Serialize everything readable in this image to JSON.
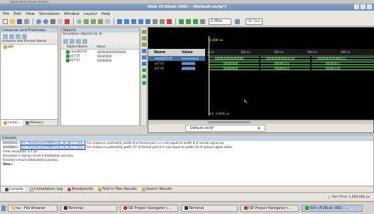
{
  "window": {
    "title": "ISim (P.28xd) (ISE) - [Default.wcfg*]",
    "sys_top_left": "Applications Places System",
    "sys_top_right": ""
  },
  "menubar": [
    "File",
    "Edit",
    "View",
    "Simulation",
    "Window",
    "Layout",
    "Help"
  ],
  "toolbar": {
    "time_field": "1.00us",
    "help_text": "ISE Text"
  },
  "instances_panel": {
    "title": "Instances and Processes",
    "subheader": "Instance and Process Name",
    "items": [
      "glbl"
    ],
    "tabs": [
      "Instan...",
      "Memory"
    ]
  },
  "objects_panel": {
    "title": "Objects",
    "subtitle": "Simulation Objects for ib",
    "col_name": "Object Name",
    "col_value": "Value",
    "items": [
      {
        "name": "result[3:0]",
        "value": "0000000000000000"
      },
      {
        "name": "a[7:0]",
        "value": "00000000"
      },
      {
        "name": "b[7:0]",
        "value": "00000000"
      }
    ]
  },
  "wave": {
    "col_name": "Name",
    "col_value": "Value",
    "cursor_time": "1,000 ns",
    "bottom_time": "X1: 0.000 us",
    "ticks": [
      "0 ns",
      "100 ns",
      "200 ns",
      "300 ns",
      "400 ns"
    ],
    "signals": [
      {
        "name": "result[15:0]",
        "value": "0000000000",
        "segments": [
          "0000000000000000",
          "0000000000001010",
          "0000000000000111"
        ]
      },
      {
        "name": "a[7:0]",
        "value": "00000000",
        "segments": [
          "00000000",
          "00000101",
          "00001011"
        ]
      },
      {
        "name": "b[7:0]",
        "value": "00000000",
        "segments": [
          "00000000",
          "00000010",
          "00000110"
        ]
      }
    ],
    "tab_label": "Default.wcfg*"
  },
  "console": {
    "title": "Console",
    "lines": [
      {
        "prefix": "WARNING:",
        "link": "File \"/home/user/RMK/mult_ab_tb.v\" Line 3",
        "text": "For instance uutmult/U_width 8 of formal port a is not equal to width 8 of actual signal aa"
      },
      {
        "prefix": "WARNING:",
        "link": "File \"/home/user/RMK/mult_ab_tb.v\" Line 3",
        "text": "For instance uutmult/U_width 17 of formal port b is not equal to width 16 of actual signal adder"
      },
      {
        "prefix": "",
        "link": "",
        "text": "Time resolution is 1 ps"
      },
      {
        "prefix": "",
        "link": "",
        "text": "Simulator is doing circuit initialization process."
      },
      {
        "prefix": "",
        "link": "",
        "text": "Finished circuit initialization process."
      },
      {
        "prefix": "",
        "link": "",
        "text": "ISim>"
      }
    ],
    "tabs": [
      "Console",
      "Compilation Log",
      "Breakpoints",
      "Find in Files Results",
      "Search Results"
    ]
  },
  "status": {
    "sim_time": "Sim Time: 1,000,000 ps"
  },
  "taskbar": [
    {
      "label": "isa - File Browser",
      "active": false
    },
    {
      "label": "Terminal",
      "active": false
    },
    {
      "label": "ISE Project Navigator (...",
      "active": false
    },
    {
      "label": "Terminal",
      "active": false
    },
    {
      "label": "ISE Project Navigator (...",
      "active": false
    },
    {
      "label": "ISim (P.28xd) (ISE) - ...",
      "active": true
    }
  ],
  "colors": {
    "wave_bg": "#000000",
    "signal_green": "#3aff3a",
    "selected_row": "#3b6ea5",
    "header_blue": "#c9d4e3"
  }
}
